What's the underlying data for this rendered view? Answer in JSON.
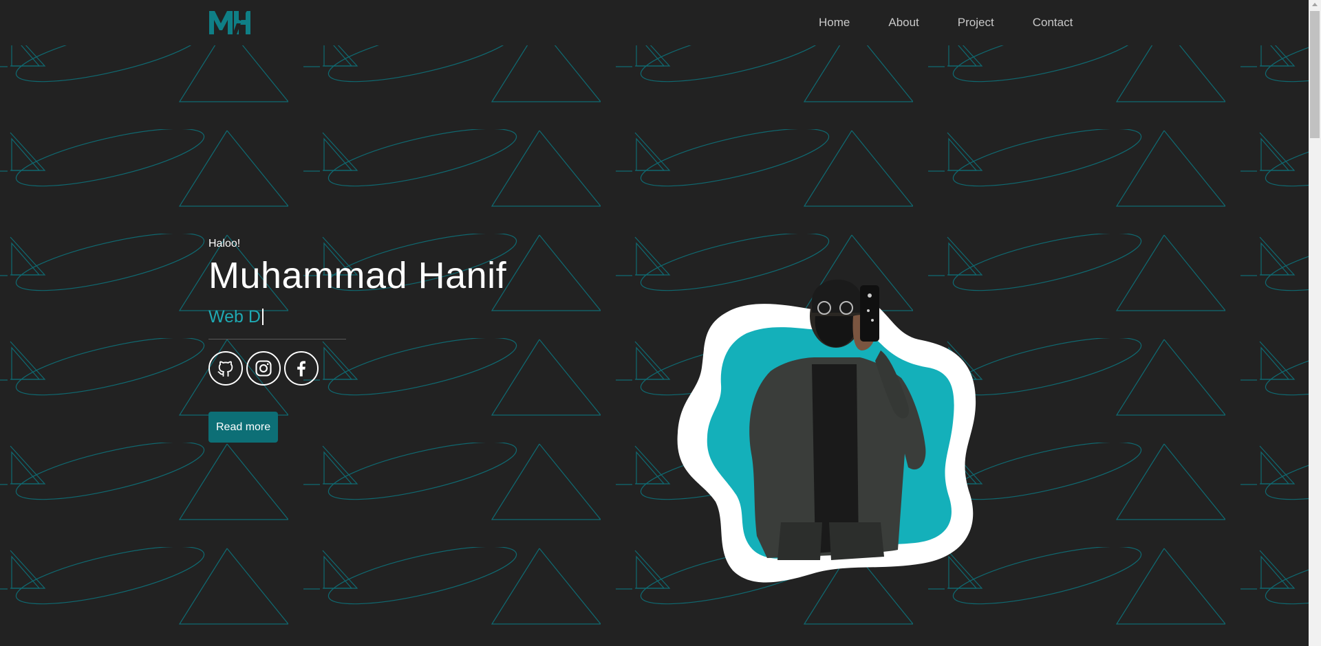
{
  "brand": {
    "logo_text": "MH",
    "accent_color": "#0f7f86",
    "highlight_color": "#1fa9b3",
    "background_color": "#222222"
  },
  "nav": {
    "items": [
      {
        "label": "Home"
      },
      {
        "label": "About"
      },
      {
        "label": "Project"
      },
      {
        "label": "Contact"
      }
    ]
  },
  "hero": {
    "greeting": "Haloo!",
    "name": "Muhammad Hanif",
    "role_typed": "Web D",
    "read_more_label": "Read more"
  },
  "socials": [
    {
      "icon": "github-icon"
    },
    {
      "icon": "instagram-icon"
    },
    {
      "icon": "facebook-icon"
    }
  ]
}
